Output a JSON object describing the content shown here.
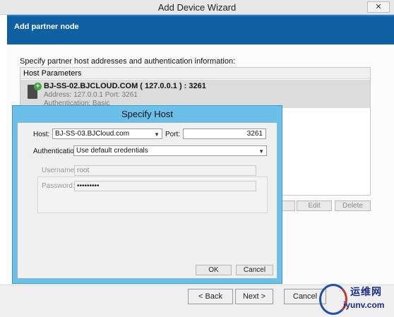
{
  "window": {
    "title": "Add Device Wizard",
    "close_glyph": "✕"
  },
  "header": {
    "title": "Add partner node"
  },
  "instructions": "Specify partner host addresses and authentication information:",
  "list": {
    "column": "Host Parameters",
    "rows": [
      {
        "name": "BJ-SS-02.BJCLOUD.COM ( 127.0.0.1 ) : 3261",
        "address": "Address: 127.0.0.1 Port: 3261",
        "auth": "Authentication: Basic"
      }
    ]
  },
  "list_buttons": {
    "edit": "Edit",
    "delete": "Delete"
  },
  "footer": {
    "back": "< Back",
    "next": "Next >",
    "cancel": "Cancel"
  },
  "dialog": {
    "title": "Specify Host",
    "host_label": "Host:",
    "host_value": "BJ-SS-03.BJCloud.com",
    "port_label": "Port:",
    "port_value": "3261",
    "auth_label": "Authentication:",
    "auth_value": "Use default credentials",
    "username_label": "Username:",
    "username_value": "root",
    "password_label": "Password:",
    "password_value": "•••••••••",
    "ok": "OK",
    "cancel": "Cancel"
  },
  "watermark": {
    "cn": "运维网",
    "url": "iyunv.com"
  },
  "colors": {
    "header": "#0f5fa3",
    "dialog_frame": "#6ac0e8",
    "row_selected": "#dcdcdc"
  }
}
